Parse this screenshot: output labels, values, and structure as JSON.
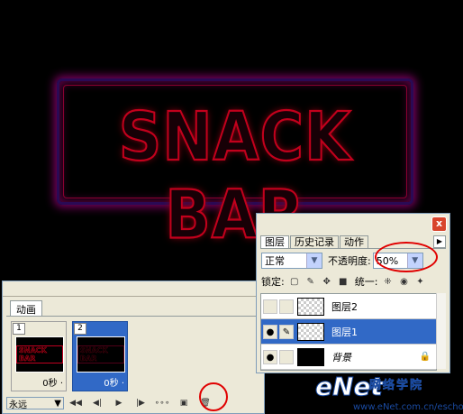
{
  "canvas": {
    "sign_text": "SNACK BAR"
  },
  "animation_panel": {
    "tab_label": "动画",
    "frames": [
      {
        "number": "1",
        "thumb_text": "SNACK BAR",
        "delay": "0秒",
        "delay_arrow": "·"
      },
      {
        "number": "2",
        "thumb_text": "SNACK BAR",
        "delay": "0秒",
        "delay_arrow": "·"
      }
    ],
    "loop_value": "永远",
    "controls": {
      "first": "◀◀",
      "prev": "◀|",
      "play": "▶",
      "next": "|▶",
      "tween": "∘∘∘",
      "new_frame": "▣",
      "delete": "🗑"
    }
  },
  "layers_panel": {
    "close_label": "x",
    "tabs": [
      "图层",
      "历史记录",
      "动作"
    ],
    "more_arrow": "▶",
    "blend_mode": "正常",
    "opacity_label": "不透明度:",
    "opacity_value": "50%",
    "lock_label": "锁定:",
    "unify_label": "统一:",
    "layers": [
      {
        "name": "图层2",
        "visible": false,
        "selected": false
      },
      {
        "name": "图层1",
        "visible": true,
        "selected": true
      },
      {
        "name": "背景",
        "visible": true,
        "selected": false,
        "locked": true
      }
    ]
  },
  "watermark": {
    "logo": "eNet",
    "cn": "网络学院",
    "url": "www.eNet.com.cn/eschool"
  }
}
